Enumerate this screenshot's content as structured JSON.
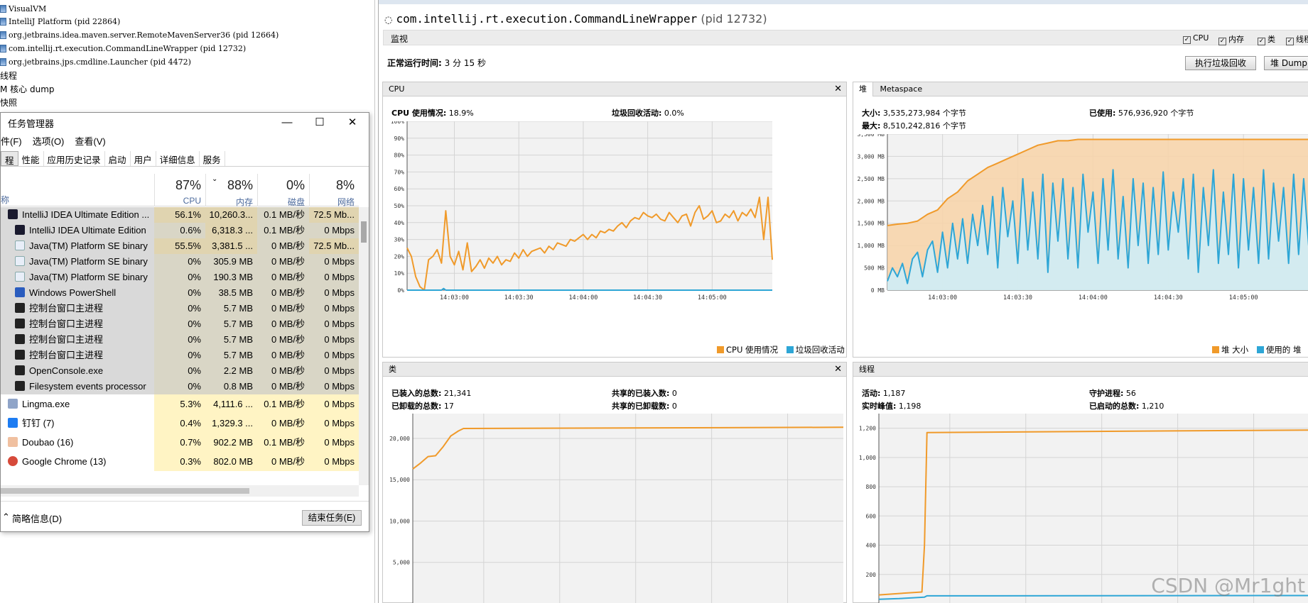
{
  "left_tree": {
    "items": [
      {
        "label": "VisualVM",
        "icon": "visualvm-icon"
      },
      {
        "label": "IntelliJ Platform (pid 22864)",
        "icon": "java-process-icon"
      },
      {
        "label": "org.jetbrains.idea.maven.server.RemoteMavenServer36 (pid 12664)",
        "icon": "java-process-icon"
      },
      {
        "label": "com.intellij.rt.execution.CommandLineWrapper (pid 12732)",
        "icon": "java-process-icon"
      },
      {
        "label": "org.jetbrains.jps.cmdline.Launcher (pid 4472)",
        "icon": "java-process-icon"
      },
      {
        "label": "线程",
        "icon": ""
      },
      {
        "label": "M 核心 dump",
        "icon": ""
      },
      {
        "label": "快照",
        "icon": ""
      }
    ]
  },
  "task_manager": {
    "title": "任务管理器",
    "menu": [
      "件(F)",
      "选项(O)",
      "查看(V)"
    ],
    "tabs": [
      "程",
      "性能",
      "应用历史记录",
      "启动",
      "用户",
      "详细信息",
      "服务"
    ],
    "active_tab": "程",
    "columns": {
      "name": "称",
      "cpu": {
        "pct": "87%",
        "label": "CPU"
      },
      "mem": {
        "pct": "88%",
        "label": "内存"
      },
      "disk": {
        "pct": "0%",
        "label": "磁盘"
      },
      "net": {
        "pct": "8%",
        "label": "网络"
      }
    },
    "rows": [
      {
        "name": "IntelliJ IDEA Ultimate Edition ...",
        "cpu": "56.1%",
        "mem": "10,260.3...",
        "disk": "0.1 MB/秒",
        "net": "72.5 Mb...",
        "icon": "intellij-icon",
        "indent": false,
        "selected": true
      },
      {
        "name": "IntelliJ IDEA Ultimate Edition",
        "cpu": "0.6%",
        "mem": "6,318.3 ...",
        "disk": "0.1 MB/秒",
        "net": "0 Mbps",
        "icon": "intellij-icon",
        "indent": true,
        "selected": true
      },
      {
        "name": "Java(TM) Platform SE binary",
        "cpu": "55.5%",
        "mem": "3,381.5 ...",
        "disk": "0 MB/秒",
        "net": "72.5 Mb...",
        "icon": "java-icon",
        "indent": true,
        "selected": true
      },
      {
        "name": "Java(TM) Platform SE binary",
        "cpu": "0%",
        "mem": "305.9 MB",
        "disk": "0 MB/秒",
        "net": "0 Mbps",
        "icon": "java-icon",
        "indent": true,
        "selected": true
      },
      {
        "name": "Java(TM) Platform SE binary",
        "cpu": "0%",
        "mem": "190.3 MB",
        "disk": "0 MB/秒",
        "net": "0 Mbps",
        "icon": "java-icon",
        "indent": true,
        "selected": true
      },
      {
        "name": "Windows PowerShell",
        "cpu": "0%",
        "mem": "38.5 MB",
        "disk": "0 MB/秒",
        "net": "0 Mbps",
        "icon": "powershell-icon",
        "indent": true,
        "selected": true
      },
      {
        "name": "控制台窗口主进程",
        "cpu": "0%",
        "mem": "5.7 MB",
        "disk": "0 MB/秒",
        "net": "0 Mbps",
        "icon": "console-icon",
        "indent": true,
        "selected": true
      },
      {
        "name": "控制台窗口主进程",
        "cpu": "0%",
        "mem": "5.7 MB",
        "disk": "0 MB/秒",
        "net": "0 Mbps",
        "icon": "console-icon",
        "indent": true,
        "selected": true
      },
      {
        "name": "控制台窗口主进程",
        "cpu": "0%",
        "mem": "5.7 MB",
        "disk": "0 MB/秒",
        "net": "0 Mbps",
        "icon": "console-icon",
        "indent": true,
        "selected": true
      },
      {
        "name": "控制台窗口主进程",
        "cpu": "0%",
        "mem": "5.7 MB",
        "disk": "0 MB/秒",
        "net": "0 Mbps",
        "icon": "console-icon",
        "indent": true,
        "selected": true
      },
      {
        "name": "OpenConsole.exe",
        "cpu": "0%",
        "mem": "2.2 MB",
        "disk": "0 MB/秒",
        "net": "0 Mbps",
        "icon": "console-icon",
        "indent": true,
        "selected": true
      },
      {
        "name": "Filesystem events processor",
        "cpu": "0%",
        "mem": "0.8 MB",
        "disk": "0 MB/秒",
        "net": "0 Mbps",
        "icon": "console-icon",
        "indent": true,
        "selected": true
      },
      {
        "name": "Lingma.exe",
        "cpu": "5.3%",
        "mem": "4,111.6 ...",
        "disk": "0.1 MB/秒",
        "net": "0 Mbps",
        "icon": "app-icon",
        "indent": false,
        "selected": false
      },
      {
        "name": "钉钉 (7)",
        "cpu": "0.4%",
        "mem": "1,329.3 ...",
        "disk": "0 MB/秒",
        "net": "0 Mbps",
        "icon": "dingtalk-icon",
        "indent": false,
        "selected": false
      },
      {
        "name": "Doubao (16)",
        "cpu": "0.7%",
        "mem": "902.2 MB",
        "disk": "0.1 MB/秒",
        "net": "0 Mbps",
        "icon": "doubao-icon",
        "indent": false,
        "selected": false
      },
      {
        "name": "Google Chrome (13)",
        "cpu": "0.3%",
        "mem": "802.0 MB",
        "disk": "0 MB/秒",
        "net": "0 Mbps",
        "icon": "chrome-icon",
        "indent": false,
        "selected": false
      }
    ],
    "footer_less": "简略信息(D)",
    "end_task": "结束任务(E)"
  },
  "monitor": {
    "process_title": "com.intellij.rt.execution.CommandLineWrapper",
    "process_pid": "(pid 12732)",
    "bar_label": "监视",
    "checkboxes": [
      "CPU",
      "内存",
      "类",
      "线程"
    ],
    "uptime_label": "正常运行时间:",
    "uptime_value": "3 分 15 秒",
    "gc_button": "执行垃圾回收",
    "heap_dump_button": "堆 Dump"
  },
  "cpu_panel": {
    "title": "CPU",
    "usage_label": "CPU 使用情况:",
    "usage_value": "18.9%",
    "gc_label": "垃圾回收活动:",
    "gc_value": "0.0%",
    "legend": [
      "CPU 使用情况",
      "垃圾回收活动"
    ]
  },
  "heap_panel": {
    "tab_heap": "堆",
    "tab_meta": "Metaspace",
    "size_label": "大小:",
    "size_value": "3,535,273,984 个字节",
    "max_label": "最大:",
    "max_value": "8,510,242,816 个字节",
    "used_label": "已使用:",
    "used_value": "576,936,920 个字节",
    "legend": [
      "堆 大小",
      "使用的 堆"
    ]
  },
  "classes_panel": {
    "title": "类",
    "loaded_label": "已装入的总数:",
    "loaded_value": "21,341",
    "unloaded_label": "已卸载的总数:",
    "unloaded_value": "17",
    "shared_loaded_label": "共享的已装入数:",
    "shared_loaded_value": "0",
    "shared_unloaded_label": "共享的已卸载数:",
    "shared_unloaded_value": "0"
  },
  "threads_panel": {
    "title": "线程",
    "live_label": "活动:",
    "live_value": "1,187",
    "peak_label": "实时峰值:",
    "peak_value": "1,198",
    "daemon_label": "守护进程:",
    "daemon_value": "56",
    "started_label": "已启动的总数:",
    "started_value": "1,210"
  },
  "watermark": "CSDN @Mr1ght",
  "colors": {
    "orange": "#f09a2a",
    "blue": "#2ea6d6",
    "orange_fill": "#f8d4a8",
    "blue_fill": "#cdeefa",
    "selected_bg": "#d9d9d9",
    "heat_yellow": "#fff4c4",
    "heat_orange": "#f9e2a6"
  },
  "chart_data": [
    {
      "type": "line",
      "title": "CPU",
      "x_ticks": [
        "14:03:00",
        "14:03:30",
        "14:04:00",
        "14:04:30",
        "14:05:00"
      ],
      "y_ticks": [
        "0%",
        "10%",
        "20%",
        "30%",
        "40%",
        "50%",
        "60%",
        "70%",
        "80%",
        "90%",
        "100%"
      ],
      "ylim": [
        0,
        100
      ],
      "x_range": [
        0,
        170
      ],
      "x_tick_positions": [
        22,
        52,
        82,
        112,
        142
      ],
      "series": [
        {
          "name": "CPU 使用情况",
          "color": "#f09a2a",
          "x": [
            0,
            2,
            4,
            6,
            8,
            10,
            12,
            14,
            16,
            18,
            20,
            22,
            24,
            26,
            28,
            30,
            32,
            34,
            36,
            38,
            40,
            42,
            44,
            46,
            48,
            50,
            52,
            54,
            56,
            58,
            60,
            62,
            64,
            66,
            68,
            70,
            72,
            74,
            76,
            78,
            80,
            82,
            84,
            86,
            88,
            90,
            92,
            94,
            96,
            98,
            100,
            102,
            104,
            106,
            108,
            110,
            112,
            114,
            116,
            118,
            120,
            122,
            124,
            126,
            128,
            130,
            132,
            134,
            136,
            138,
            140,
            142,
            144,
            146,
            148,
            150,
            152,
            154,
            156,
            158,
            160,
            162,
            164,
            166,
            168,
            170
          ],
          "y": [
            25,
            20,
            8,
            2,
            0,
            18,
            20,
            24,
            16,
            47,
            20,
            15,
            23,
            12,
            28,
            11,
            14,
            18,
            13,
            19,
            16,
            20,
            15,
            18,
            17,
            22,
            19,
            24,
            20,
            23,
            24,
            25,
            22,
            26,
            24,
            28,
            27,
            26,
            30,
            29,
            31,
            33,
            30,
            33,
            31,
            35,
            34,
            36,
            35,
            38,
            40,
            37,
            41,
            43,
            42,
            46,
            44,
            43,
            45,
            42,
            41,
            46,
            43,
            40,
            44,
            45,
            38,
            46,
            50,
            42,
            44,
            47,
            40,
            41,
            45,
            43,
            47,
            41,
            46,
            44,
            48,
            43,
            55,
            30,
            55,
            18
          ]
        },
        {
          "name": "垃圾回收活动",
          "color": "#2ea6d6",
          "x": [
            0,
            16,
            17,
            18,
            170
          ],
          "y": [
            0,
            0,
            1,
            0,
            0
          ]
        }
      ]
    },
    {
      "type": "area",
      "title": "堆",
      "x_ticks": [
        "14:03:00",
        "14:03:30",
        "14:04:00",
        "14:04:30",
        "14:05:00"
      ],
      "y_ticks": [
        "0 MB",
        "500 MB",
        "1,000 MB",
        "1,500 MB",
        "2,000 MB",
        "2,500 MB",
        "3,000 MB",
        "3,500 MB"
      ],
      "ylim": [
        0,
        3500
      ],
      "x_range": [
        0,
        170
      ],
      "x_tick_positions": [
        22,
        52,
        82,
        112,
        142
      ],
      "series": [
        {
          "name": "堆 大小",
          "color": "#f09a2a",
          "x": [
            0,
            4,
            8,
            12,
            16,
            20,
            24,
            28,
            32,
            36,
            40,
            44,
            48,
            52,
            56,
            60,
            64,
            68,
            72,
            76,
            80,
            90,
            100,
            110,
            120,
            130,
            140,
            150,
            160,
            170
          ],
          "y": [
            1450,
            1480,
            1500,
            1550,
            1700,
            1800,
            2050,
            2200,
            2450,
            2600,
            2750,
            2850,
            2950,
            3050,
            3150,
            3250,
            3300,
            3350,
            3350,
            3380,
            3380,
            3380,
            3380,
            3380,
            3380,
            3380,
            3380,
            3380,
            3380,
            3380
          ]
        },
        {
          "name": "使用的 堆",
          "color": "#2ea6d6",
          "x": [
            0,
            2,
            4,
            6,
            8,
            10,
            12,
            14,
            16,
            18,
            20,
            22,
            24,
            26,
            28,
            30,
            32,
            34,
            36,
            38,
            40,
            42,
            44,
            46,
            48,
            50,
            52,
            54,
            56,
            58,
            60,
            62,
            64,
            66,
            68,
            70,
            72,
            74,
            76,
            78,
            80,
            82,
            84,
            86,
            88,
            90,
            92,
            94,
            96,
            98,
            100,
            102,
            104,
            106,
            108,
            110,
            112,
            114,
            116,
            118,
            120,
            122,
            124,
            126,
            128,
            130,
            132,
            134,
            136,
            138,
            140,
            142,
            144,
            146,
            148,
            150,
            152,
            154,
            156,
            158,
            160,
            162,
            164,
            166,
            168,
            170
          ],
          "y": [
            200,
            500,
            300,
            600,
            150,
            700,
            850,
            300,
            900,
            1100,
            400,
            1300,
            500,
            1500,
            700,
            1600,
            600,
            1700,
            1000,
            1900,
            800,
            2100,
            500,
            2300,
            1200,
            2000,
            600,
            2500,
            900,
            2200,
            700,
            2600,
            400,
            2400,
            1100,
            2500,
            700,
            2300,
            500,
            2600,
            1300,
            2200,
            600,
            2500,
            900,
            2700,
            700,
            2100,
            500,
            2500,
            1000,
            2400,
            600,
            2300,
            800,
            2650,
            900,
            2200,
            1300,
            2500,
            700,
            2600,
            400,
            2300,
            1000,
            2700,
            600,
            2200,
            800,
            2600,
            500,
            2500,
            900,
            2300,
            600,
            2700,
            700,
            2400,
            1100,
            2300,
            600,
            2600,
            800,
            2500,
            1000,
            2400
          ]
        }
      ]
    },
    {
      "type": "line",
      "title": "类",
      "y_ticks": [
        "5,000",
        "10,000",
        "15,000",
        "20,000"
      ],
      "ylim": [
        0,
        23000
      ],
      "x_range": [
        0,
        170
      ],
      "x_tick_positions": [
        28,
        58,
        88,
        118,
        148
      ],
      "series": [
        {
          "name": "已装入的总数",
          "color": "#f09a2a",
          "x": [
            0,
            3,
            6,
            9,
            12,
            15,
            18,
            20,
            170
          ],
          "y": [
            16300,
            17000,
            17800,
            17900,
            19000,
            20300,
            20900,
            21200,
            21341
          ]
        }
      ]
    },
    {
      "type": "line",
      "title": "线程",
      "y_ticks": [
        "200",
        "400",
        "600",
        "800",
        "1,000",
        "1,200"
      ],
      "ylim": [
        0,
        1300
      ],
      "x_range": [
        0,
        170
      ],
      "x_tick_positions": [
        28,
        58,
        88,
        118,
        148
      ],
      "series": [
        {
          "name": "活动",
          "color": "#f09a2a",
          "x": [
            0,
            8,
            17,
            18,
            19,
            60,
            100,
            170
          ],
          "y": [
            60,
            70,
            80,
            400,
            1170,
            1175,
            1180,
            1187
          ]
        },
        {
          "name": "守护进程",
          "color": "#2ea6d6",
          "x": [
            0,
            8,
            18,
            19,
            170
          ],
          "y": [
            30,
            35,
            45,
            54,
            56
          ]
        }
      ]
    }
  ]
}
